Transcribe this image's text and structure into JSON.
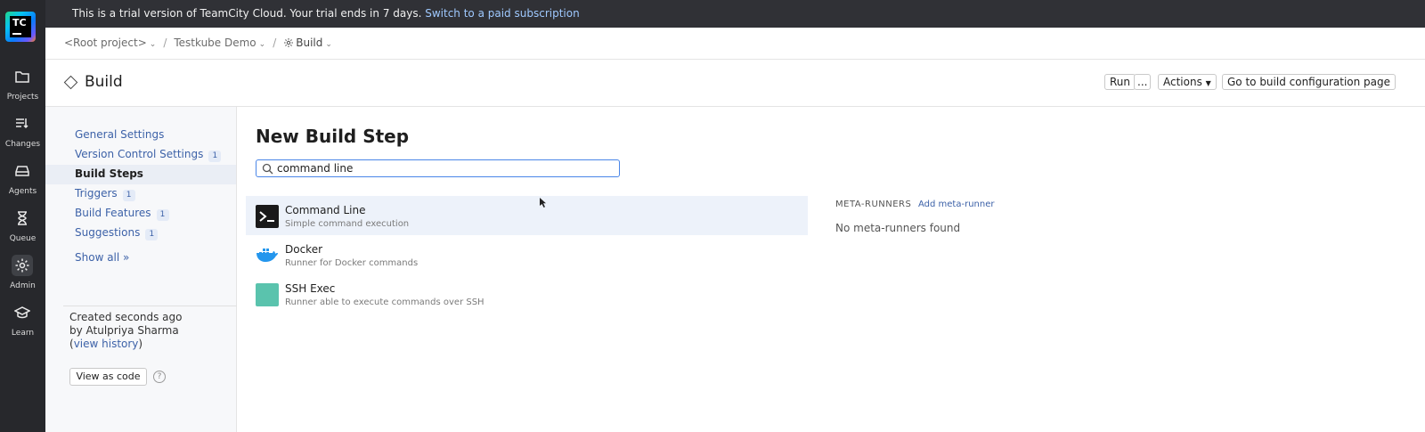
{
  "rail": {
    "logo_text": "TC",
    "items": [
      {
        "label": "Projects",
        "icon": "folder-icon"
      },
      {
        "label": "Changes",
        "icon": "changes-icon"
      },
      {
        "label": "Agents",
        "icon": "agents-icon"
      },
      {
        "label": "Queue",
        "icon": "hourglass-icon"
      },
      {
        "label": "Admin",
        "icon": "gear-icon",
        "active": true
      },
      {
        "label": "Learn",
        "icon": "graduation-cap-icon"
      }
    ]
  },
  "banner": {
    "text": "This is a trial version of TeamCity Cloud. Your trial ends in 7 days.",
    "link": "Switch to a paid subscription"
  },
  "breadcrumb": [
    {
      "label": "<Root project>"
    },
    {
      "label": "Testkube Demo"
    },
    {
      "label": "Build",
      "icon": "gear-icon"
    }
  ],
  "header": {
    "title": "Build",
    "run_label": "Run",
    "run_more_label": "...",
    "actions_label": "Actions",
    "goto_label": "Go to build configuration page"
  },
  "sidebar": {
    "items": [
      {
        "label": "General Settings",
        "count": null
      },
      {
        "label": "Version Control Settings",
        "count": "1"
      },
      {
        "label": "Build Steps",
        "count": null,
        "active": true
      },
      {
        "label": "Triggers",
        "count": "1"
      },
      {
        "label": "Build Features",
        "count": "1"
      },
      {
        "label": "Suggestions",
        "count": "1"
      }
    ],
    "show_all": "Show all »",
    "created_line1": "Created seconds ago",
    "created_line2": "by Atulpriya Sharma",
    "history_open": "(",
    "history_link": "view history",
    "history_close": ")",
    "view_as_code": "View as code",
    "help": "?"
  },
  "main": {
    "heading": "New Build Step",
    "search_value": "command line",
    "runners": [
      {
        "name": "Command Line",
        "desc": "Simple command execution",
        "icon": "terminal-icon",
        "selected": true
      },
      {
        "name": "Docker",
        "desc": "Runner for Docker commands",
        "icon": "docker-icon"
      },
      {
        "name": "SSH Exec",
        "desc": "Runner able to execute commands over SSH",
        "icon": "ssh-exec-icon"
      }
    ],
    "meta_runners_title": "META-RUNNERS",
    "add_meta_runner": "Add meta-runner",
    "no_meta_runners": "No meta-runners found"
  },
  "colors": {
    "rail_bg": "#27282c",
    "banner_bg": "#303136",
    "link": "#3d62a8",
    "selected_row": "#edf2fa",
    "search_border": "#4a86e8",
    "ssh_icon": "#5ac3ad"
  }
}
